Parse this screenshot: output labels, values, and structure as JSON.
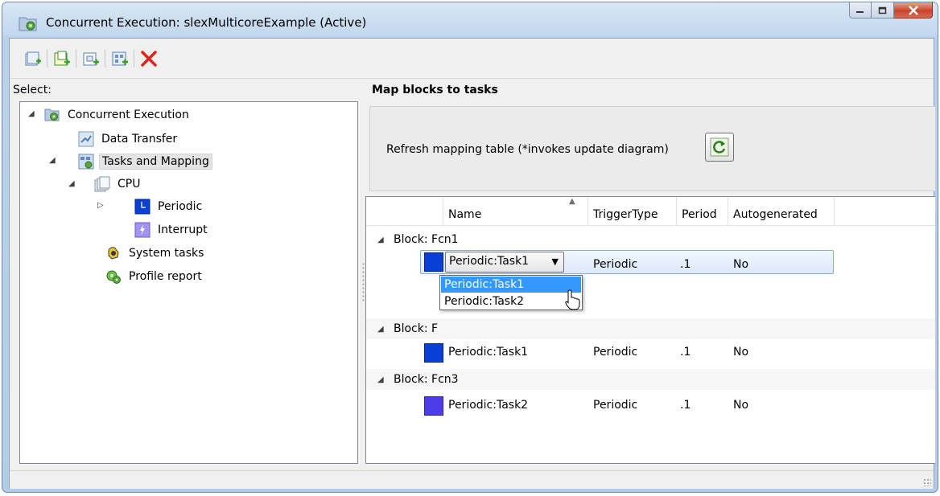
{
  "window": {
    "title": "Concurrent Execution: slexMulticoreExample (Active)",
    "controls": {
      "minimize": "minimize",
      "maximize": "maximize",
      "close": "close"
    }
  },
  "toolbar": {
    "buttons": [
      "add-task-icon",
      "add-periodic-icon",
      "add-trigger-icon",
      "add-profile-icon",
      "delete-icon"
    ]
  },
  "left_pane": {
    "label": "Select:",
    "tree": [
      {
        "label": "Concurrent Execution",
        "icon": "concurrent-execution-icon",
        "expanded": true
      },
      {
        "label": "Data Transfer",
        "icon": "data-transfer-icon"
      },
      {
        "label": "Tasks and Mapping",
        "icon": "tasks-mapping-icon",
        "expanded": true,
        "selected": true
      },
      {
        "label": "CPU",
        "icon": "cpu-icon",
        "expanded": true
      },
      {
        "label": "Periodic",
        "icon": "periodic-icon",
        "expanded": false
      },
      {
        "label": "Interrupt",
        "icon": "interrupt-icon"
      },
      {
        "label": "System tasks",
        "icon": "system-tasks-icon"
      },
      {
        "label": "Profile report",
        "icon": "profile-report-icon"
      }
    ]
  },
  "right_pane": {
    "title": "Map blocks to tasks",
    "refresh_label": "Refresh mapping table (*invokes update diagram)",
    "refresh_icon": "refresh-icon",
    "columns": [
      "Name",
      "TriggerType",
      "Period",
      "Autogenerated"
    ],
    "groups": [
      {
        "label": "Block: Fcn1",
        "row": {
          "name": "Periodic:Task1",
          "trigger": "Periodic",
          "period": ".1",
          "auto": "No",
          "color": "#0a3fd6"
        }
      },
      {
        "label": "Block: F",
        "row": {
          "name": "Periodic:Task1",
          "trigger": "Periodic",
          "period": ".1",
          "auto": "No",
          "color": "#0a3fd6"
        }
      },
      {
        "label": "Block: Fcn3",
        "row": {
          "name": "Periodic:Task2",
          "trigger": "Periodic",
          "period": ".1",
          "auto": "No",
          "color": "#4b3ce8"
        }
      }
    ],
    "combo_value": "Periodic:Task1",
    "dropdown_options": [
      "Periodic:Task1",
      "Periodic:Task2"
    ]
  },
  "colors": {
    "selection_blue": "#3399ff",
    "task1": "#0a3fd6",
    "task2": "#4b3ce8",
    "delete_red": "#e0241b"
  }
}
